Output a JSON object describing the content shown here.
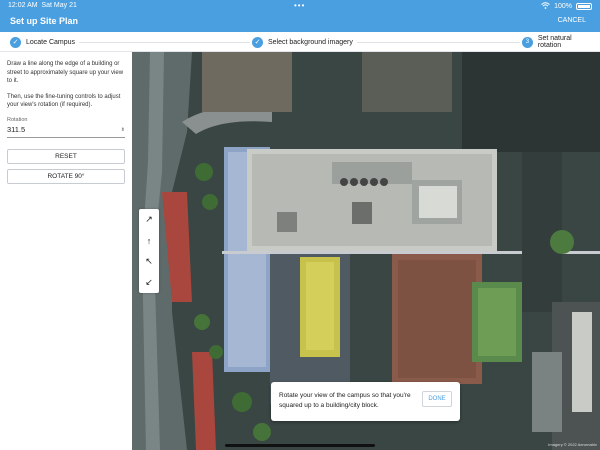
{
  "status": {
    "time": "12:02 AM",
    "date": "Sat May 21",
    "wifi_icon": "wifi-icon",
    "battery": "100%",
    "battery_icon": "battery-icon",
    "dots": "•••"
  },
  "header": {
    "title": "Set up Site Plan",
    "cancel_label": "CANCEL",
    "color": "#4a9fe0"
  },
  "steps": [
    {
      "label": "Locate Campus",
      "state": "complete",
      "icon": "check-icon",
      "marker": "✓"
    },
    {
      "label": "Select background imagery",
      "state": "complete",
      "icon": "check-icon",
      "marker": "✓"
    },
    {
      "label": "Set natural rotation",
      "state": "current",
      "icon": "step-number-icon",
      "marker": "3"
    }
  ],
  "panel": {
    "instruction_1": "Draw a line along the edge of a building or street to approximately square up your view to it.",
    "instruction_2": "Then, use the fine-tuning controls to adjust your view's rotation (if required).",
    "rotation_label": "Rotation",
    "rotation_value": "311.5",
    "reset_label": "RESET",
    "rotate90_label": "ROTATE 90°"
  },
  "fine_tune": [
    {
      "glyph": "↗",
      "icon": "rotate-cw-large-icon"
    },
    {
      "glyph": "↑",
      "icon": "rotate-cw-small-icon"
    },
    {
      "glyph": "↖",
      "icon": "rotate-ccw-small-icon"
    },
    {
      "glyph": "↙",
      "icon": "rotate-ccw-large-icon"
    }
  ],
  "toast": {
    "text": "Rotate your view of the campus so that you're squared up to a building/city block.",
    "done_label": "DONE"
  },
  "map": {
    "attribution": "Imagery © 2022 Aeromatrix"
  }
}
